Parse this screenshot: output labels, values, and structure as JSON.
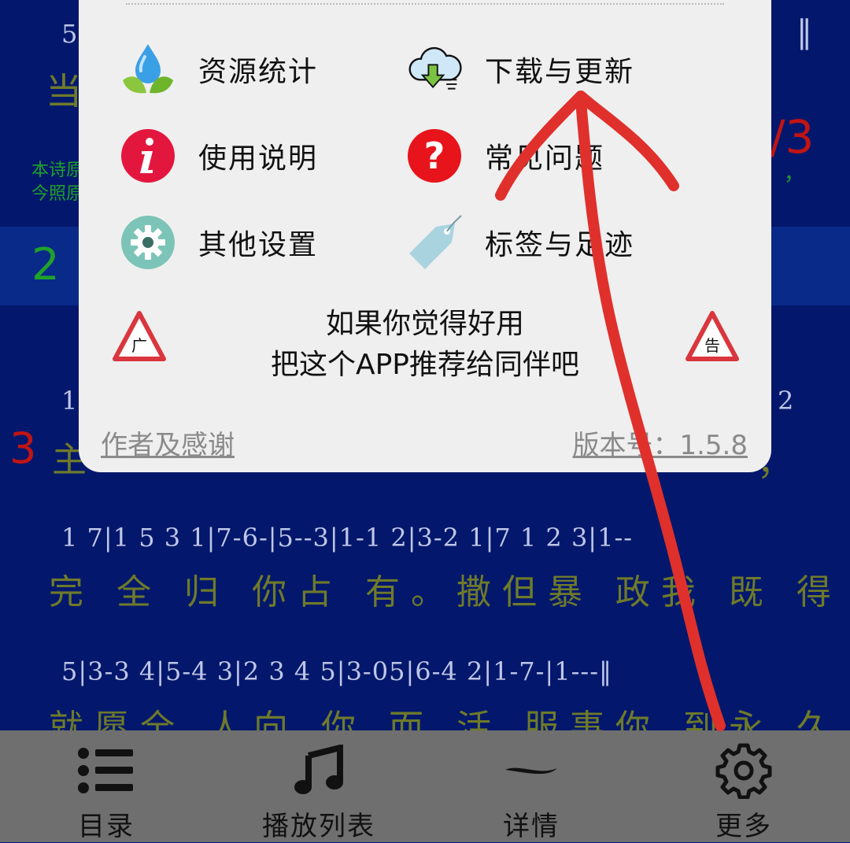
{
  "background": {
    "colors": {
      "page": "#03186c",
      "lyrics": "#6f7a2a",
      "notes": "#bfc6e6",
      "accent_green": "#1fa12a",
      "accent_red": "#c21414"
    },
    "partial_top_number": "5",
    "partial_top_lyric": "当",
    "partial_red_text": "/3",
    "side_text_lines": [
      "本诗原",
      "今照原"
    ],
    "side_text_tail": "，",
    "section_number_2": "2",
    "row_number_1": "1",
    "row_number_right": "2",
    "section_number_3": "3",
    "row3_lyric_start": "主",
    "row3_lyric_tail": "，",
    "notes_row_a": "1 7|1 5 3 1|7-6-|5--3|1-1 2|3-2 1|7 1 2 3|1--",
    "lyrics_row_a": "完 全 归 你占 有。撒但暴 政我 既 得 脱,",
    "notes_row_b": "5|3-3 4|5-4 3|2 3 4 5|3-05|6-4 2|1-7-|1---‖",
    "lyrics_row_b": "就愿全 人向 你 而 活,服事你 到永 久。"
  },
  "popup": {
    "menu": [
      {
        "label": "资源统计",
        "icon": "water-drop-leaves-icon"
      },
      {
        "label": "下载与更新",
        "icon": "cloud-download-icon"
      },
      {
        "label": "使用说明",
        "icon": "info-icon"
      },
      {
        "label": "常见问题",
        "icon": "question-icon"
      },
      {
        "label": "其他设置",
        "icon": "gear-icon"
      },
      {
        "label": "标签与足迹",
        "icon": "tag-icon"
      }
    ],
    "ad": {
      "line1": "如果你觉得好用",
      "line2": "把这个APP推荐给同伴吧",
      "left_badge": "广",
      "right_badge": "告"
    },
    "footer": {
      "credits_link": "作者及感谢",
      "version_link": "版本号：1.5.8"
    }
  },
  "tabbar": {
    "tabs": [
      {
        "label": "目录",
        "icon": "list-icon"
      },
      {
        "label": "播放列表",
        "icon": "music-note-icon"
      },
      {
        "label": "详情",
        "icon": "details-swoosh-icon"
      },
      {
        "label": "更多",
        "icon": "gear-icon"
      }
    ]
  }
}
